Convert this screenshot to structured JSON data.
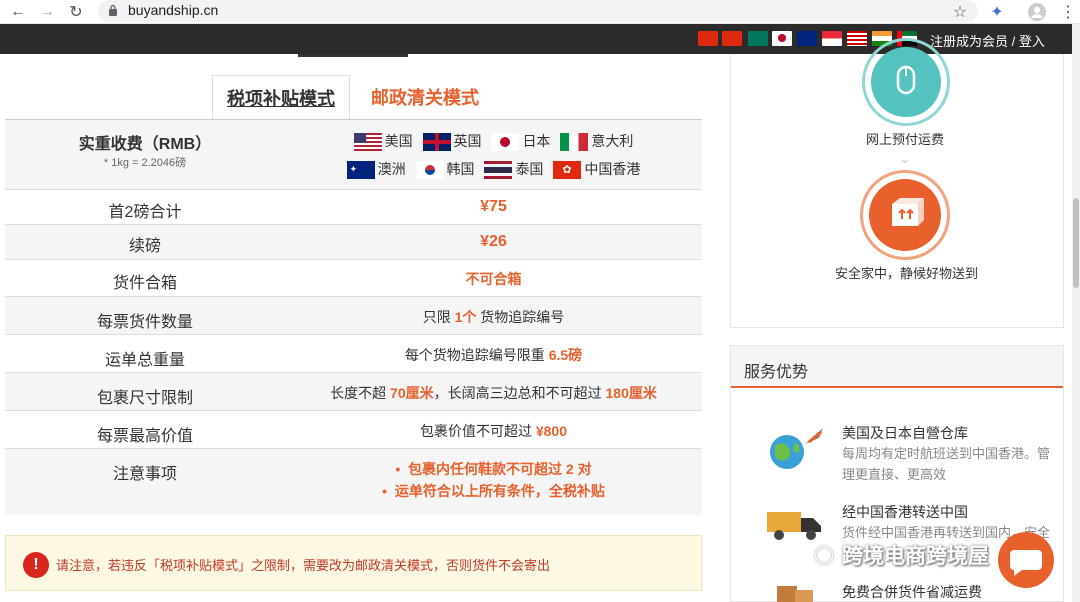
{
  "browser": {
    "url": "buyandship.cn"
  },
  "sitebar": {
    "register_link": "注册成为会员 / 登入"
  },
  "tabs": {
    "active": "税项补贴模式",
    "other": "邮政清关模式"
  },
  "table": {
    "header_label": "实重收费（RMB）",
    "header_sub": "* 1kg = 2.2046磅",
    "countries": [
      "美国",
      "英国",
      "日本",
      "意大利",
      "澳洲",
      "韩国",
      "泰国",
      "中国香港"
    ],
    "rows": [
      {
        "label": "首2磅合计",
        "value": "¥75"
      },
      {
        "label": "续磅",
        "value": "¥26"
      },
      {
        "label": "货件合箱",
        "value": "不可合箱"
      },
      {
        "label": "每票货件数量",
        "v1": "只限",
        "v2": "1个",
        "v3": "货物追踪编号"
      },
      {
        "label": "运单总重量",
        "v1": "每个货物追踪编号限重",
        "v2": "6.5磅"
      },
      {
        "label": "包裹尺寸限制",
        "v1": "长度不超",
        "v2": "70厘米",
        "v3": "，长阔高三边总和不可超过",
        "v4": "180厘米"
      },
      {
        "label": "每票最高价值",
        "v1": "包裹价值不可超过",
        "v2": "¥800"
      },
      {
        "label": "注意事项",
        "notes": [
          "包裹内任何鞋款不可超过 2 对",
          "运单符合以上所有条件，全税补贴"
        ]
      }
    ]
  },
  "notice": {
    "text": "请注意，若违反「税项补贴模式」之限制，需要改为邮政清关模式，否则货件不会寄出"
  },
  "right": {
    "step1": "网上预付运费",
    "step2": "安全家中，静候好物送到",
    "services_title": "服务优势",
    "features": [
      {
        "title": "美国及日本自營仓库",
        "desc": "每周均有定时航班送到中国香港。管理更直接、更高效"
      },
      {
        "title": "经中国香港转送中国",
        "desc": "货件经中国香港再转送到国内，安全"
      },
      {
        "title": "免费合併货件省减运费",
        "desc": ""
      }
    ]
  },
  "watermark": "跨境电商跨境屋"
}
